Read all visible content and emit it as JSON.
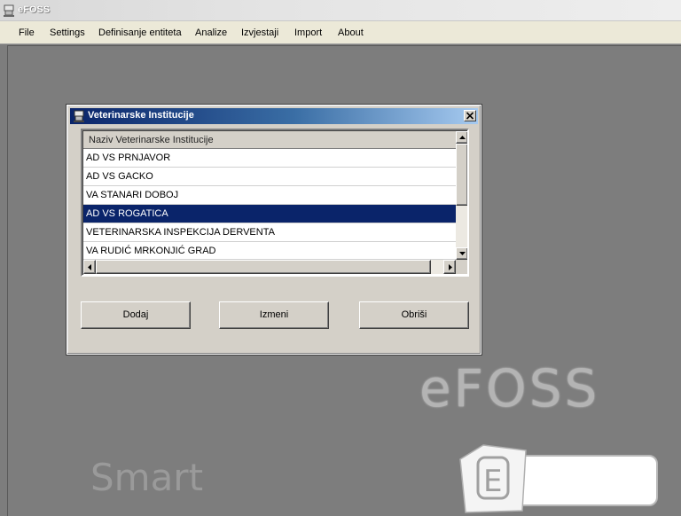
{
  "app": {
    "title": "eFOSS",
    "icon": "app-icon"
  },
  "menu": {
    "items": [
      "File",
      "Settings",
      "Definisanje entiteta",
      "Analize",
      "Izvjestaji",
      "Import",
      "About"
    ]
  },
  "dialog": {
    "title": "Veterinarske Institucije",
    "icon": "app-icon",
    "close_label": "X",
    "grid": {
      "column_header": "Naziv Veterinarske Institucije",
      "rows": [
        "AD VS PRNJAVOR",
        "AD VS GACKO",
        "VA STANARI DOBOJ",
        "AD VS ROGATICA",
        "VETERINARSKA INSPEKCIJA DERVENTA",
        "VA RUDIĆ MRKONJIĆ GRAD"
      ],
      "selected_row": "AD VS ROGATICA"
    },
    "buttons": {
      "add": "Dodaj",
      "edit": "Izmeni",
      "delete": "Obriši"
    }
  },
  "branding": {
    "logo_text": "eFOSS",
    "badge_letter": "E",
    "badge_text": "Smart"
  },
  "colors": {
    "workspace": "#7d7d7d",
    "title_active": "#0a246a",
    "selection": "#0a246a",
    "face": "#d4d0c8"
  }
}
